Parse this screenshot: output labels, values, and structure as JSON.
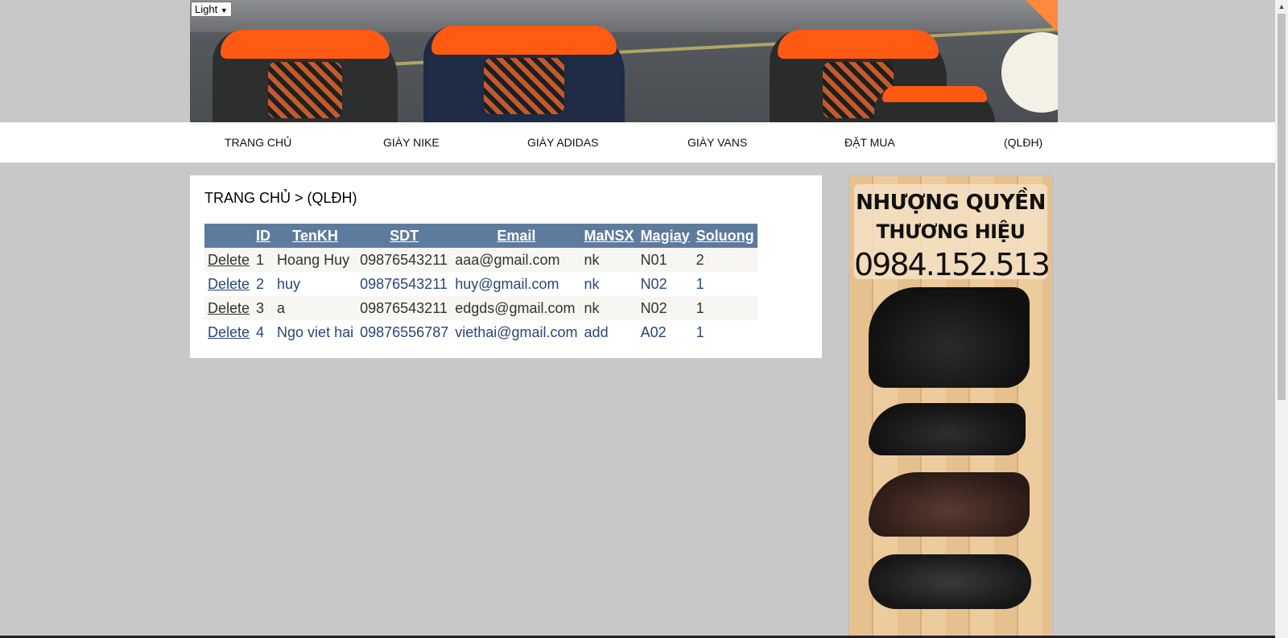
{
  "theme_select": {
    "value": "Light"
  },
  "nav": {
    "items": [
      {
        "label": "TRANG CHỦ"
      },
      {
        "label": "GIÀY NIKE"
      },
      {
        "label": "GIÀY ADIDAS"
      },
      {
        "label": "GIÀY VANS"
      },
      {
        "label": "ĐẶT MUA"
      },
      {
        "label": "(QLĐH)"
      }
    ]
  },
  "breadcrumb": "TRANG CHỦ > (QLĐH)",
  "table": {
    "headers": [
      "",
      "ID",
      "TenKH",
      "SDT",
      "Email",
      "MaNSX",
      "Magiay",
      "Soluong"
    ],
    "rows": [
      {
        "action": "Delete",
        "id": "1",
        "tenkh": "Hoang Huy",
        "sdt": "09876543211",
        "email": "aaa@gmail.com",
        "mansx": "nk",
        "magiay": "N01",
        "soluong": "2"
      },
      {
        "action": "Delete",
        "id": "2",
        "tenkh": "huy",
        "sdt": "09876543211",
        "email": "huy@gmail.com",
        "mansx": "nk",
        "magiay": "N02",
        "soluong": "1"
      },
      {
        "action": "Delete",
        "id": "3",
        "tenkh": "a",
        "sdt": "09876543211",
        "email": "edgds@gmail.com",
        "mansx": "nk",
        "magiay": "N02",
        "soluong": "1"
      },
      {
        "action": "Delete",
        "id": "4",
        "tenkh": "Ngo viet hai",
        "sdt": "09876556787",
        "email": "viethai@gmail.com",
        "mansx": "add",
        "magiay": "A02",
        "soluong": "1"
      }
    ]
  },
  "ad": {
    "line1": "NHƯỢNG QUYỀN",
    "line2": "THƯƠNG HIỆU",
    "phone": "0984.152.513"
  },
  "colors": {
    "header_bg": "#5d7b9d",
    "row_alt_bg": "#f7f6f3",
    "link_blue": "#284775",
    "page_bg": "#c8c8c8"
  }
}
